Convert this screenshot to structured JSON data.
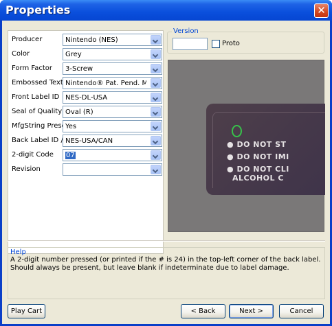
{
  "window": {
    "title": "Properties",
    "close_glyph": "✕"
  },
  "fields": [
    {
      "label": "Producer",
      "value": "Nintendo (NES)",
      "selected": false
    },
    {
      "label": "Color",
      "value": "Grey",
      "selected": false
    },
    {
      "label": "Form Factor",
      "value": "3-Screw",
      "selected": false
    },
    {
      "label": "Embossed Text",
      "value": "Nintendo® Pat. Pend. Made",
      "selected": false
    },
    {
      "label": "Front Label ID",
      "value": "NES-DL-USA",
      "selected": false
    },
    {
      "label": "Seal of Quality",
      "value": "Oval (R)",
      "selected": false
    },
    {
      "label": "MfgString Present",
      "value": "Yes",
      "selected": false
    },
    {
      "label": "Back Label ID / D",
      "value": "NES-USA/CAN",
      "selected": false
    },
    {
      "label": "2-digit Code",
      "value": "07",
      "selected": true
    },
    {
      "label": "Revision",
      "value": "",
      "selected": false
    }
  ],
  "version": {
    "legend": "Version",
    "value": "",
    "proto_label": "Proto",
    "proto_checked": false
  },
  "photo": {
    "lines": [
      "DO NOT ST",
      "DO NOT IMI",
      "DO NOT CLI",
      "ALCOHOL C"
    ],
    "bullets": [
      true,
      true,
      true,
      false
    ]
  },
  "help": {
    "title": "Help",
    "text": "A 2-digit number pressed (or printed if the # is 24) in the top-left corner of the back label. Should always be present, but leave blank if indeterminate due to label damage."
  },
  "buttons": {
    "play_cart": "Play Cart",
    "back": "< Back",
    "next": "Next >",
    "cancel": "Cancel"
  }
}
